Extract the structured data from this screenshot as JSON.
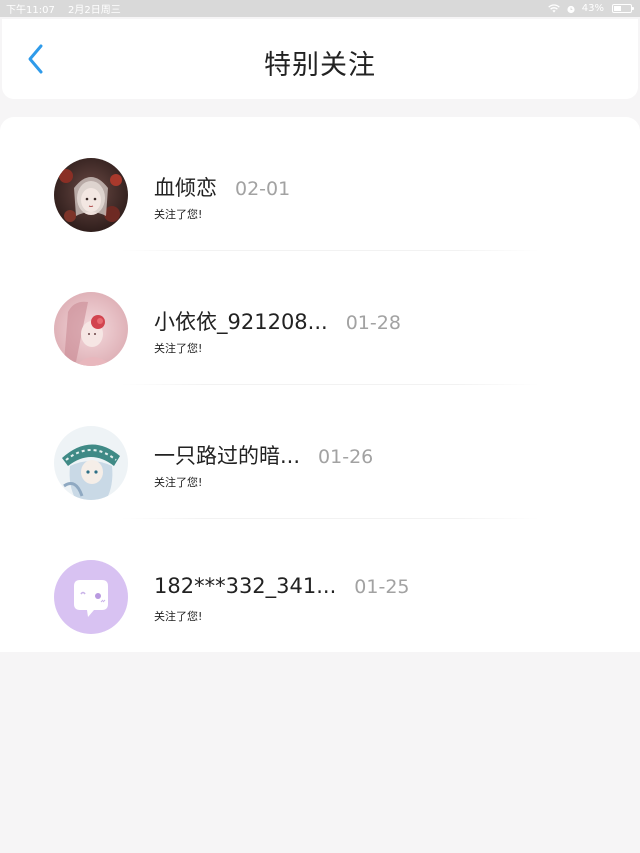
{
  "status_bar": {
    "time": "下午11:07",
    "date": "2月2日周三",
    "battery": "43%",
    "battery_level": 0.43
  },
  "header": {
    "title": "特别关注",
    "back_icon": "chevron-left-icon",
    "accent": "#2f9bea"
  },
  "follows": [
    {
      "name": "血倾恋",
      "date": "02-01",
      "message": "关注了您!",
      "avatar": "dark-floral-portrait"
    },
    {
      "name": "小依依_921208...",
      "date": "01-28",
      "message": "关注了您!",
      "avatar": "pink-floral-portrait"
    },
    {
      "name": "一只路过的暗...",
      "date": "01-26",
      "message": "关注了您!",
      "avatar": "anime-character-portrait"
    },
    {
      "name": "182***332_341...",
      "date": "01-25",
      "message": "关注了您!",
      "avatar": "default-chat-bubble-avatar"
    }
  ]
}
